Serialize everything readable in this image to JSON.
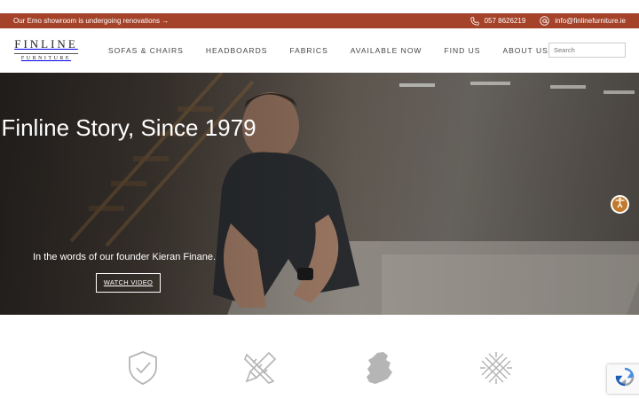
{
  "announcement": {
    "text": "Our Emo showroom is undergoing renovations →",
    "phone": "057 8626219",
    "email": "info@finlinefurniture.ie"
  },
  "logo": {
    "main": "FINLINE",
    "sub": "FURNITURE"
  },
  "nav": {
    "items": [
      "SOFAS & CHAIRS",
      "HEADBOARDS",
      "FABRICS",
      "AVAILABLE NOW",
      "FIND US",
      "ABOUT US"
    ]
  },
  "search": {
    "placeholder": "Search"
  },
  "hero": {
    "title": "Finline Story, Since 1979",
    "subtitle": "In the words of our founder Kieran Finane.",
    "button": "WATCH VIDEO"
  },
  "features": {
    "icons": [
      "shield-check-icon",
      "tools-icon",
      "ireland-map-icon",
      "weave-pattern-icon"
    ]
  },
  "colors": {
    "brand": "#a4432a",
    "accessibility": "#c07a2c",
    "icon_grey": "#b5b5b5"
  }
}
